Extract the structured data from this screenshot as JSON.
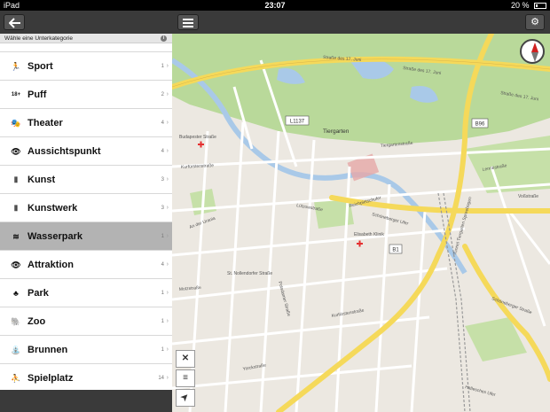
{
  "status": {
    "device": "iPad",
    "time": "23:07",
    "battery": "20 %"
  },
  "sidebar": {
    "subheader": "Wähle eine Unterkategorie",
    "info": "i",
    "items": [
      {
        "label": "Sport",
        "count": "1",
        "icon": "runner-icon",
        "glyph": "🏃"
      },
      {
        "label": "Puff",
        "count": "2",
        "icon": "18-plus-icon",
        "glyph": "18+"
      },
      {
        "label": "Theater",
        "count": "4",
        "icon": "theater-masks-icon",
        "glyph": "🎭"
      },
      {
        "label": "Aussichtspunkt",
        "count": "4",
        "icon": "eye-icon",
        "glyph": "👁"
      },
      {
        "label": "Kunst",
        "count": "3",
        "icon": "column-icon",
        "glyph": "Ⅱ"
      },
      {
        "label": "Kunstwerk",
        "count": "3",
        "icon": "monument-icon",
        "glyph": "Ⅱ"
      },
      {
        "label": "Wasserpark",
        "count": "1",
        "icon": "water-park-icon",
        "glyph": "≋",
        "selected": true
      },
      {
        "label": "Attraktion",
        "count": "4",
        "icon": "eye-icon",
        "glyph": "👁"
      },
      {
        "label": "Park",
        "count": "1",
        "icon": "tree-icon",
        "glyph": "♣"
      },
      {
        "label": "Zoo",
        "count": "1",
        "icon": "elephant-icon",
        "glyph": "🐘"
      },
      {
        "label": "Brunnen",
        "count": "1",
        "icon": "fountain-icon",
        "glyph": "⛲"
      },
      {
        "label": "Spielplatz",
        "count": "14",
        "icon": "playground-icon",
        "glyph": "⛹"
      }
    ]
  },
  "map": {
    "labels": {
      "strasse_17_juni_a": "Straße des 17. Juni",
      "strasse_17_juni_b": "Straße des 17. Juni",
      "strasse_17_juni_c": "Straße des 17. Juni",
      "l1137": "L1137",
      "b96": "B96",
      "b1": "B1",
      "tiergarten": "Tiergarten",
      "tiergartenstrasse": "Tiergartenstraße",
      "budapester": "Budapester Straße",
      "kurfuerstenstrasse": "Kurfürstenstraße",
      "luetzowstrasse": "Lützowstraße",
      "schoeneberger_ufer": "Schöneberger Ufer",
      "elisabeth": "Elisabeth Klinik",
      "reichpietschufer": "Reichpietschufer",
      "an_der_urania": "An der Urania",
      "motzstrasse": "Motzstraße",
      "st_nollendorf": "St. Nollendorfer Straße",
      "potsdamer": "Potsdamer Straße",
      "kurfuerstenstr2": "Kurfürstenstraße",
      "yorckstrasse": "Yorckstraße",
      "tunnel": "Tunnel Tiergarten Spreebogen",
      "hallesche": "Hallesches Ufer",
      "schoeneberger": "Schöneberger Straße",
      "leipziger": "Lennéstraße",
      "ebertstrasse": "Voßstraße"
    },
    "compass_label": "N"
  },
  "tools": {
    "clear": "✕",
    "list": "≡",
    "locate": "➤"
  },
  "colors": {
    "bar": "#3a3a3a",
    "selected": "#b3b3b3",
    "park": "#b9d99a",
    "water": "#a9c9e8",
    "major_road": "#f5d95a"
  }
}
